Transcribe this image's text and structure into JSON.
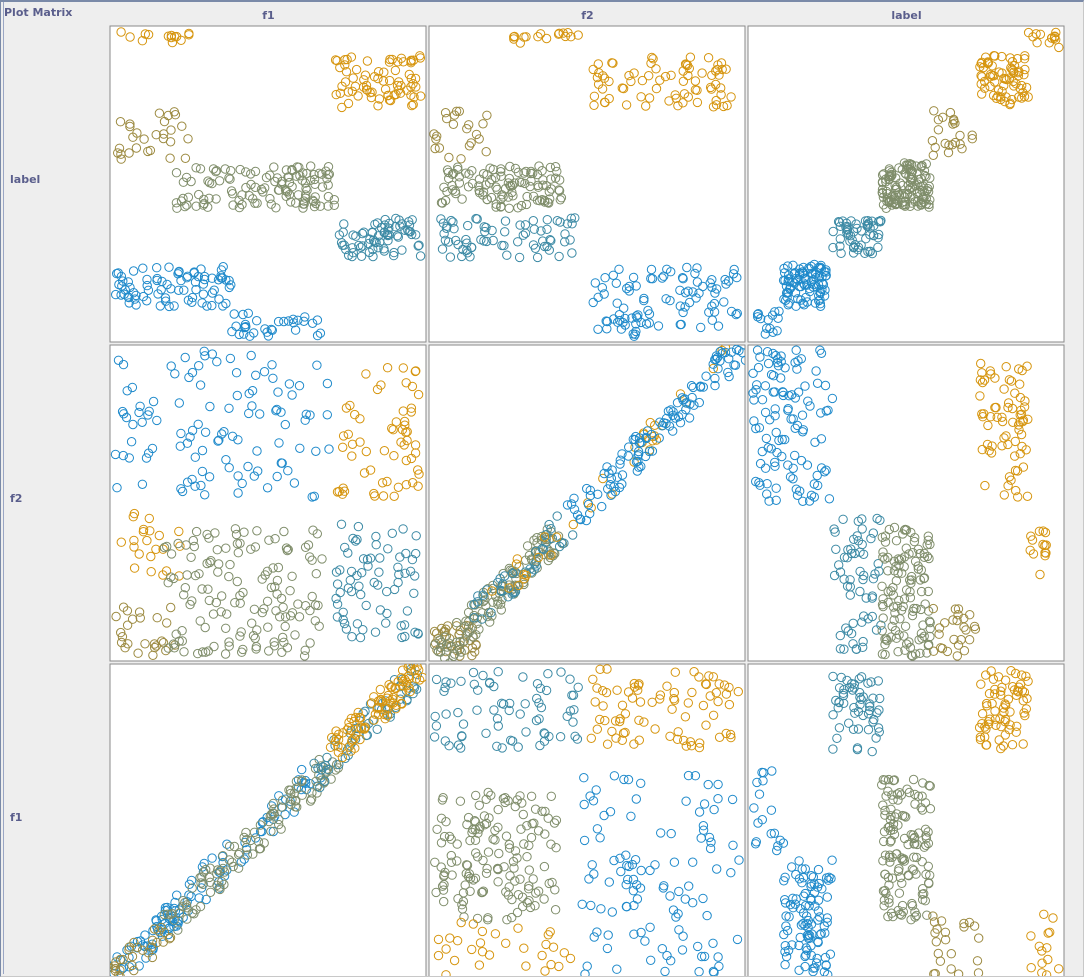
{
  "title": "Plot Matrix",
  "chart_data": {
    "type": "scatter",
    "columns": [
      "f1",
      "f2",
      "label"
    ],
    "rows": [
      "label",
      "f2",
      "f1"
    ],
    "colors": {
      "cluster-blue": "#1f8acb",
      "cluster-teal": "#3c8aa5",
      "cluster-olive": "#7f8d6a",
      "cluster-brown": "#9c8a40",
      "cluster-orange": "#d6950e"
    },
    "marker": "open-circle",
    "cells": [
      {
        "row": "label",
        "col": "f1",
        "groups": [
          {
            "color": "cluster-orange",
            "n": 14,
            "x": [
              0.02,
              0.26
            ],
            "y": [
              0.96,
              1.0
            ]
          },
          {
            "color": "cluster-orange",
            "n": 75,
            "x": [
              0.72,
              1.0
            ],
            "y": [
              0.75,
              0.92
            ]
          },
          {
            "color": "cluster-brown",
            "n": 28,
            "x": [
              0.0,
              0.24
            ],
            "y": [
              0.58,
              0.74
            ]
          },
          {
            "color": "cluster-olive",
            "n": 120,
            "x": [
              0.2,
              0.72
            ],
            "y": [
              0.42,
              0.56
            ]
          },
          {
            "color": "cluster-teal",
            "n": 70,
            "x": [
              0.72,
              1.0
            ],
            "y": [
              0.26,
              0.39
            ]
          },
          {
            "color": "cluster-blue",
            "n": 80,
            "x": [
              0.0,
              0.38
            ],
            "y": [
              0.1,
              0.23
            ]
          },
          {
            "color": "cluster-blue",
            "n": 32,
            "x": [
              0.38,
              0.68
            ],
            "y": [
              0.0,
              0.08
            ]
          }
        ]
      },
      {
        "row": "label",
        "col": "f2",
        "groups": [
          {
            "color": "cluster-orange",
            "n": 16,
            "x": [
              0.26,
              0.48
            ],
            "y": [
              0.96,
              1.0
            ]
          },
          {
            "color": "cluster-orange",
            "n": 75,
            "x": [
              0.52,
              0.98
            ],
            "y": [
              0.75,
              0.92
            ]
          },
          {
            "color": "cluster-brown",
            "n": 22,
            "x": [
              0.0,
              0.18
            ],
            "y": [
              0.58,
              0.74
            ]
          },
          {
            "color": "cluster-olive",
            "n": 110,
            "x": [
              0.02,
              0.42
            ],
            "y": [
              0.42,
              0.56
            ]
          },
          {
            "color": "cluster-teal",
            "n": 70,
            "x": [
              0.02,
              0.46
            ],
            "y": [
              0.26,
              0.39
            ]
          },
          {
            "color": "cluster-blue",
            "n": 95,
            "x": [
              0.52,
              1.0
            ],
            "y": [
              0.0,
              0.23
            ]
          }
        ]
      },
      {
        "row": "label",
        "col": "label",
        "groups": [
          {
            "color": "cluster-blue",
            "n": 14,
            "x": [
              0.0,
              0.1
            ],
            "y": [
              0.0,
              0.09
            ]
          },
          {
            "color": "cluster-blue",
            "n": 90,
            "x": [
              0.1,
              0.24
            ],
            "y": [
              0.1,
              0.24
            ]
          },
          {
            "color": "cluster-teal",
            "n": 55,
            "x": [
              0.26,
              0.42
            ],
            "y": [
              0.27,
              0.39
            ]
          },
          {
            "color": "cluster-olive",
            "n": 130,
            "x": [
              0.42,
              0.58
            ],
            "y": [
              0.42,
              0.57
            ]
          },
          {
            "color": "cluster-brown",
            "n": 22,
            "x": [
              0.58,
              0.72
            ],
            "y": [
              0.59,
              0.74
            ]
          },
          {
            "color": "cluster-orange",
            "n": 70,
            "x": [
              0.74,
              0.9
            ],
            "y": [
              0.75,
              0.92
            ]
          },
          {
            "color": "cluster-orange",
            "n": 14,
            "x": [
              0.9,
              1.0
            ],
            "y": [
              0.94,
              1.0
            ]
          }
        ]
      },
      {
        "row": "f2",
        "col": "f1",
        "groups": [
          {
            "color": "cluster-blue",
            "n": 110,
            "x": [
              0.0,
              0.7
            ],
            "y": [
              0.52,
              1.0
            ]
          },
          {
            "color": "cluster-orange",
            "n": 60,
            "x": [
              0.72,
              1.0
            ],
            "y": [
              0.52,
              0.95
            ]
          },
          {
            "color": "cluster-orange",
            "n": 22,
            "x": [
              0.0,
              0.22
            ],
            "y": [
              0.25,
              0.48
            ]
          },
          {
            "color": "cluster-brown",
            "n": 25,
            "x": [
              0.0,
              0.2
            ],
            "y": [
              0.0,
              0.16
            ]
          },
          {
            "color": "cluster-olive",
            "n": 140,
            "x": [
              0.16,
              0.68
            ],
            "y": [
              0.0,
              0.42
            ]
          },
          {
            "color": "cluster-teal",
            "n": 70,
            "x": [
              0.72,
              1.0
            ],
            "y": [
              0.06,
              0.44
            ]
          }
        ]
      },
      {
        "row": "f2",
        "col": "f2",
        "groups": [
          {
            "color": "cluster-brown",
            "n": 35,
            "x": [
              0.0,
              0.14
            ],
            "y": [
              0.0,
              0.1
            ]
          },
          {
            "color": "cluster-olive",
            "n": 120,
            "x": [
              0.02,
              0.4
            ],
            "y": [
              0.0,
              0.4
            ],
            "diag": true
          },
          {
            "color": "cluster-teal",
            "n": 40,
            "x": [
              0.1,
              0.46
            ],
            "y": [
              0.1,
              0.46
            ],
            "diag": true
          },
          {
            "color": "cluster-orange",
            "n": 35,
            "x": [
              0.2,
              1.0
            ],
            "y": [
              0.2,
              1.0
            ],
            "diag": true
          },
          {
            "color": "cluster-blue",
            "n": 110,
            "x": [
              0.46,
              1.0
            ],
            "y": [
              0.46,
              1.0
            ],
            "diag": true
          }
        ]
      },
      {
        "row": "f2",
        "col": "label",
        "groups": [
          {
            "color": "cluster-blue",
            "n": 110,
            "x": [
              0.0,
              0.26
            ],
            "y": [
              0.5,
              1.0
            ]
          },
          {
            "color": "cluster-orange",
            "n": 70,
            "x": [
              0.74,
              0.9
            ],
            "y": [
              0.5,
              0.96
            ]
          },
          {
            "color": "cluster-orange",
            "n": 14,
            "x": [
              0.9,
              1.0
            ],
            "y": [
              0.26,
              0.48
            ]
          },
          {
            "color": "cluster-teal",
            "n": 60,
            "x": [
              0.26,
              0.42
            ],
            "y": [
              0.0,
              0.45
            ]
          },
          {
            "color": "cluster-olive",
            "n": 120,
            "x": [
              0.42,
              0.58
            ],
            "y": [
              0.0,
              0.42
            ]
          },
          {
            "color": "cluster-brown",
            "n": 25,
            "x": [
              0.58,
              0.74
            ],
            "y": [
              0.0,
              0.16
            ]
          }
        ]
      },
      {
        "row": "f1",
        "col": "f1",
        "groups": [
          {
            "color": "cluster-blue",
            "n": 70,
            "x": [
              0.0,
              0.34
            ],
            "y": [
              0.0,
              0.34
            ],
            "diag": true
          },
          {
            "color": "cluster-blue",
            "n": 40,
            "x": [
              0.3,
              0.66
            ],
            "y": [
              0.32,
              0.66
            ],
            "diag": true
          },
          {
            "color": "cluster-brown",
            "n": 30,
            "x": [
              0.0,
              0.18
            ],
            "y": [
              0.0,
              0.16
            ],
            "diag": true
          },
          {
            "color": "cluster-olive",
            "n": 110,
            "x": [
              0.16,
              0.72
            ],
            "y": [
              0.16,
              0.7
            ],
            "diag": true
          },
          {
            "color": "cluster-teal",
            "n": 55,
            "x": [
              0.62,
              1.0
            ],
            "y": [
              0.62,
              1.0
            ],
            "diag": true
          },
          {
            "color": "cluster-orange",
            "n": 90,
            "x": [
              0.7,
              1.0
            ],
            "y": [
              0.72,
              1.0
            ],
            "diag": true
          }
        ]
      },
      {
        "row": "f1",
        "col": "f2",
        "groups": [
          {
            "color": "cluster-teal",
            "n": 70,
            "x": [
              0.0,
              0.5
            ],
            "y": [
              0.74,
              1.0
            ]
          },
          {
            "color": "cluster-orange",
            "n": 80,
            "x": [
              0.5,
              1.0
            ],
            "y": [
              0.74,
              1.0
            ]
          },
          {
            "color": "cluster-olive",
            "n": 150,
            "x": [
              0.0,
              0.4
            ],
            "y": [
              0.18,
              0.6
            ]
          },
          {
            "color": "cluster-blue",
            "n": 110,
            "x": [
              0.48,
              1.0
            ],
            "y": [
              0.0,
              0.66
            ]
          },
          {
            "color": "cluster-orange",
            "n": 30,
            "x": [
              0.0,
              0.46
            ],
            "y": [
              0.0,
              0.18
            ]
          }
        ]
      },
      {
        "row": "f1",
        "col": "label",
        "groups": [
          {
            "color": "cluster-teal",
            "n": 55,
            "x": [
              0.26,
              0.42
            ],
            "y": [
              0.72,
              1.0
            ]
          },
          {
            "color": "cluster-orange",
            "n": 70,
            "x": [
              0.74,
              0.9
            ],
            "y": [
              0.74,
              1.0
            ]
          },
          {
            "color": "cluster-blue",
            "n": 18,
            "x": [
              0.0,
              0.1
            ],
            "y": [
              0.4,
              0.68
            ]
          },
          {
            "color": "cluster-olive",
            "n": 130,
            "x": [
              0.42,
              0.58
            ],
            "y": [
              0.18,
              0.64
            ]
          },
          {
            "color": "cluster-blue",
            "n": 100,
            "x": [
              0.1,
              0.26
            ],
            "y": [
              0.0,
              0.38
            ]
          },
          {
            "color": "cluster-brown",
            "n": 22,
            "x": [
              0.58,
              0.74
            ],
            "y": [
              0.0,
              0.2
            ]
          },
          {
            "color": "cluster-orange",
            "n": 14,
            "x": [
              0.9,
              1.0
            ],
            "y": [
              0.0,
              0.2
            ]
          }
        ]
      }
    ]
  }
}
